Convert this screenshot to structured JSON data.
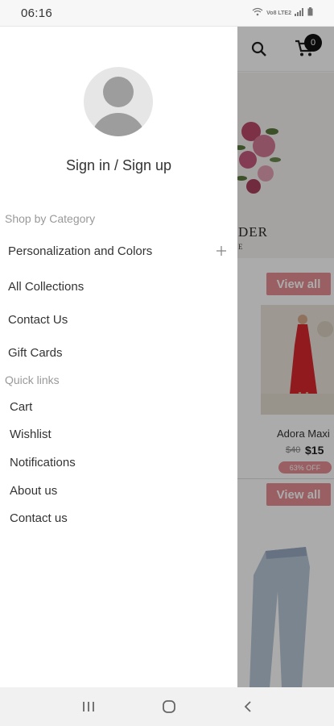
{
  "status_bar": {
    "time": "06:16",
    "volte_label": "Vo8 LTE2"
  },
  "background": {
    "cart_count": "0",
    "banner_text": "DER",
    "banner_sub": "E",
    "view_all_label": "View all",
    "product_name": "Adora Maxi",
    "price_old": "$40",
    "price_new": "$15",
    "discount_label": "63% OFF"
  },
  "drawer": {
    "signin_label": "Sign in / Sign up",
    "shop_by_category": "Shop by Category",
    "categories": [
      {
        "label": "Personalization and Colors",
        "expandable": true
      },
      {
        "label": "All Collections"
      },
      {
        "label": "Contact Us"
      },
      {
        "label": "Gift Cards"
      }
    ],
    "quick_links_label": "Quick links",
    "quick_links": [
      {
        "label": "Cart"
      },
      {
        "label": "Wishlist"
      },
      {
        "label": "Notifications"
      },
      {
        "label": "About us"
      },
      {
        "label": "Contact us"
      }
    ]
  },
  "colors": {
    "accent": "#e58e92",
    "overlay": "#00000055"
  }
}
